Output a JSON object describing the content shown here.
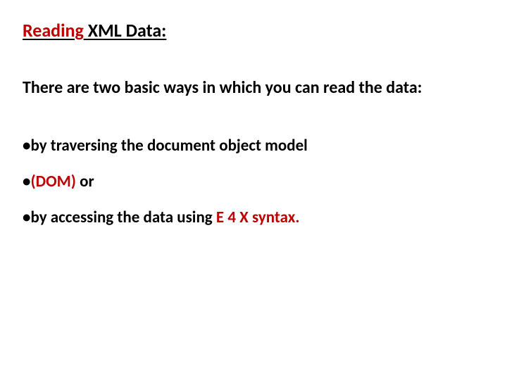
{
  "title": {
    "part1": "Reading",
    "part2": " XML Data:"
  },
  "intro": "There are two basic ways in which you can read the data:",
  "bullets": {
    "b1": {
      "dot": "•",
      "text": "by traversing the document object model"
    },
    "b2": {
      "dot": "•",
      "accent": "(DOM)",
      "rest": " or"
    },
    "b3": {
      "dot": "•",
      "pre": "by accessing the data using ",
      "accent": "E 4 X syntax."
    }
  }
}
